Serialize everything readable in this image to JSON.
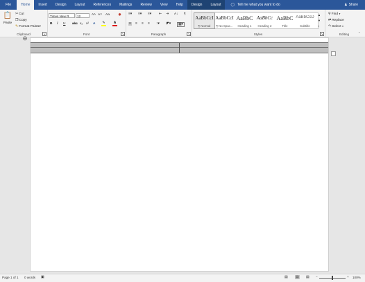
{
  "tabs": [
    "File",
    "Home",
    "Insert",
    "Design",
    "Layout",
    "References",
    "Mailings",
    "Review",
    "View",
    "Help",
    "Design",
    "Layout"
  ],
  "active_tab": "Home",
  "tell_me": "Tell me what you want to do",
  "share": "Share",
  "clipboard": {
    "paste": "Paste",
    "cut": "Cut",
    "copy": "Copy",
    "format_painter": "Format Painter",
    "label": "Clipboard"
  },
  "font": {
    "name": "Times New R",
    "size": "12",
    "bold": "B",
    "italic": "I",
    "underline": "U",
    "strike": "abc",
    "subscript": "x₂",
    "superscript": "x²",
    "aa": "Aa",
    "grow": "A˄",
    "shrink": "A˅",
    "label": "Font"
  },
  "paragraph": {
    "label": "Paragraph",
    "pilcrow": "¶"
  },
  "styles": {
    "label": "Styles",
    "items": [
      {
        "preview": "AaBbCcI",
        "name": "¶ Normal"
      },
      {
        "preview": "AaBbCcI",
        "name": "¶ No Spac..."
      },
      {
        "preview": "AaBbC",
        "name": "Heading 1"
      },
      {
        "preview": "AaBbCc",
        "name": "Heading 2"
      },
      {
        "preview": "AaBbC",
        "name": "Title"
      },
      {
        "preview": "AaBbCcD",
        "name": "Subtitle"
      }
    ]
  },
  "editing": {
    "find": "Find",
    "replace": "Replace",
    "select": "Select",
    "label": "Editing"
  },
  "status": {
    "page": "Page 1 of 1",
    "words": "0 words",
    "zoom": "100%"
  },
  "colors": {
    "brand": "#2b579a",
    "highlight": "#ffff00",
    "font_color": "#e00000"
  }
}
